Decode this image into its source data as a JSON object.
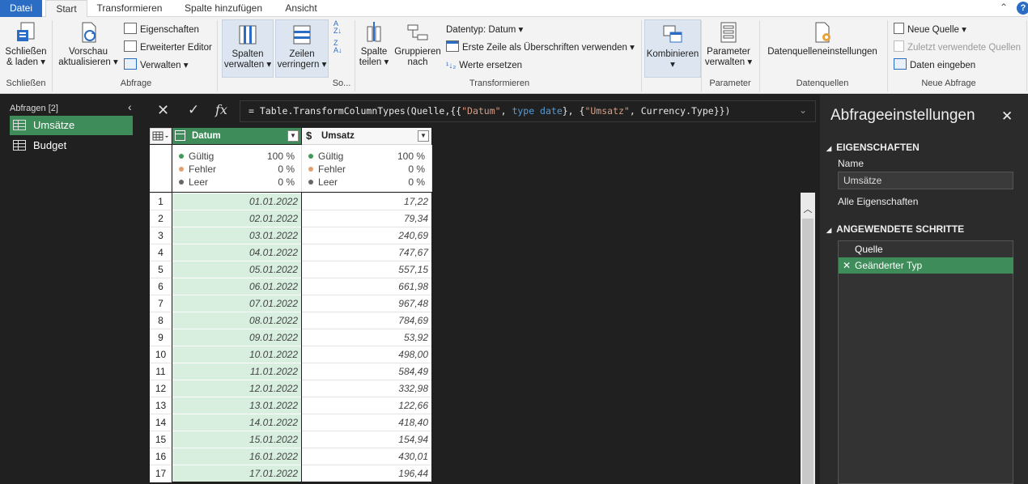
{
  "menu": {
    "tabs": [
      "Datei",
      "Start",
      "Transformieren",
      "Spalte hinzufügen",
      "Ansicht"
    ]
  },
  "ribbon": {
    "close_load": [
      "Schließen",
      "& laden"
    ],
    "group_close": "Schließen",
    "refresh": [
      "Vorschau",
      "aktualisieren"
    ],
    "properties": "Eigenschaften",
    "advanced_editor": "Erweiterter Editor",
    "manage": "Verwalten",
    "group_query": "Abfrage",
    "columns": [
      "Spalten",
      "verwalten"
    ],
    "rows": [
      "Zeilen",
      "verringern"
    ],
    "sort_label": "So...",
    "split": [
      "Spalte",
      "teilen"
    ],
    "group_by": [
      "Gruppieren",
      "nach"
    ],
    "datatype": "Datentyp: Datum",
    "first_row_header": "Erste Zeile als Überschriften verwenden",
    "replace_values": "Werte ersetzen",
    "group_transform": "Transformieren",
    "combine": "Kombinieren",
    "parameters": [
      "Parameter",
      "verwalten"
    ],
    "group_parameters": "Parameter",
    "datasource_settings": "Datenquelleneinstellungen",
    "group_datasources": "Datenquellen",
    "new_source": "Neue Quelle",
    "recent_sources": "Zuletzt verwendete Quellen",
    "enter_data": "Daten eingeben",
    "group_new_query": "Neue Abfrage"
  },
  "queries": {
    "header": "Abfragen [2]",
    "items": [
      "Umsätze",
      "Budget"
    ]
  },
  "formula": {
    "prefix": "= Table.TransformColumnTypes(Quelle,{{",
    "s1": "\"Datum\"",
    "sep1": ", ",
    "kw1": "type date",
    "mid": "}, {",
    "s2": "\"Umsatz\"",
    "tail": ", Currency.Type}})"
  },
  "grid": {
    "columns": [
      {
        "name": "Datum",
        "type_icon": "calendar-icon"
      },
      {
        "name": "Umsatz",
        "type_icon": "$"
      }
    ],
    "profile_labels": [
      "Gültig",
      "Fehler",
      "Leer"
    ],
    "profile_colors": [
      "#3e9b5a",
      "#e0a070",
      "#666666"
    ],
    "datum_profile": [
      "100 %",
      "0 %",
      "0 %"
    ],
    "umsatz_profile": [
      "100 %",
      "0 %",
      "0 %"
    ],
    "rows": [
      [
        "1",
        "01.01.2022",
        "17,22"
      ],
      [
        "2",
        "02.01.2022",
        "79,34"
      ],
      [
        "3",
        "03.01.2022",
        "240,69"
      ],
      [
        "4",
        "04.01.2022",
        "747,67"
      ],
      [
        "5",
        "05.01.2022",
        "557,15"
      ],
      [
        "6",
        "06.01.2022",
        "661,98"
      ],
      [
        "7",
        "07.01.2022",
        "967,48"
      ],
      [
        "8",
        "08.01.2022",
        "784,69"
      ],
      [
        "9",
        "09.01.2022",
        "53,92"
      ],
      [
        "10",
        "10.01.2022",
        "498,00"
      ],
      [
        "11",
        "11.01.2022",
        "584,49"
      ],
      [
        "12",
        "12.01.2022",
        "332,98"
      ],
      [
        "13",
        "13.01.2022",
        "122,66"
      ],
      [
        "14",
        "14.01.2022",
        "418,40"
      ],
      [
        "15",
        "15.01.2022",
        "154,94"
      ],
      [
        "16",
        "16.01.2022",
        "430,01"
      ],
      [
        "17",
        "17.01.2022",
        "196,44"
      ]
    ]
  },
  "settings": {
    "title": "Abfrageeinstellungen",
    "properties_header": "EIGENSCHAFTEN",
    "name_label": "Name",
    "name_value": "Umsätze",
    "all_properties": "Alle Eigenschaften",
    "steps_header": "ANGEWENDETE SCHRITTE",
    "steps": [
      "Quelle",
      "Geänderter Typ"
    ]
  }
}
